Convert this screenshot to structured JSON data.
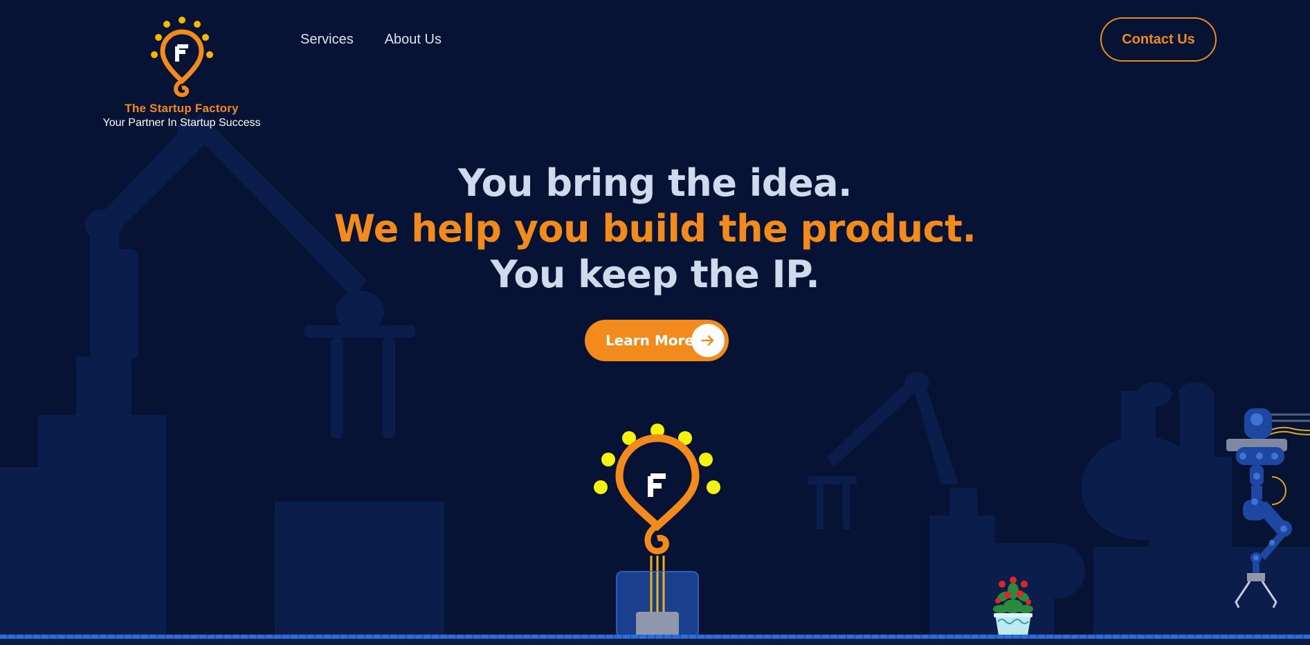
{
  "header": {
    "logo": {
      "name": "The Startup Factory",
      "tagline": "Your Partner In Startup Success",
      "icon": "lightbulb-f-icon"
    },
    "nav": [
      {
        "label": "Services"
      },
      {
        "label": "About Us"
      }
    ],
    "contact_label": "Contact Us"
  },
  "hero": {
    "line1": "You bring the idea.",
    "line2": "We help you build the product.",
    "line3": "You keep the IP.",
    "cta_label": "Learn More",
    "cta_icon": "arrow-right-icon"
  },
  "illustrations": {
    "bulb": "lightbulb-machine-illustration",
    "plant": "potted-plant-illustration",
    "robot": "robot-arm-illustration",
    "background": "factory-silhouette-background"
  },
  "colors": {
    "background": "#061334",
    "accent": "#f28a1c",
    "text_light": "#cfdbec",
    "silhouette": "#0b1d4a",
    "bulb_glow": "#f5f20e",
    "robot_blue": "#1d47a0"
  }
}
